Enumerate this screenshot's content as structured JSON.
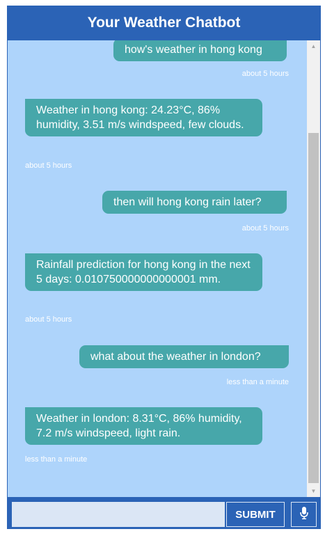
{
  "header": {
    "title": "Your Weather Chatbot"
  },
  "messages": [
    {
      "role": "user",
      "text": "how's weather in hong kong",
      "time": "about 5 hours"
    },
    {
      "role": "bot",
      "text": "Weather in hong kong: 24.23°C, 86% humidity, 3.51 m/s windspeed, few clouds.",
      "time": "about 5 hours"
    },
    {
      "role": "user",
      "text": "then will hong kong rain later?",
      "time": "about 5 hours"
    },
    {
      "role": "bot",
      "text": "Rainfall prediction for hong kong in the next 5 days: 0.010750000000000001 mm.",
      "time": "about 5 hours"
    },
    {
      "role": "user",
      "text": "what about the weather in london?",
      "time": "less than a minute"
    },
    {
      "role": "bot",
      "text": "Weather in london: 8.31°C, 86% humidity, 7.2 m/s windspeed, light rain.",
      "time": "less than a minute"
    }
  ],
  "input": {
    "value": "",
    "placeholder": ""
  },
  "submit_label": "SUBMIT",
  "icons": {
    "mic": "microphone-icon",
    "scroll_up": "arrow-up-icon",
    "scroll_down": "arrow-down-icon"
  },
  "colors": {
    "header": "#2b63b6",
    "chat_bg": "#aed4fb",
    "bubble": "#47a7aa",
    "input_bg": "#dbe6f5"
  }
}
